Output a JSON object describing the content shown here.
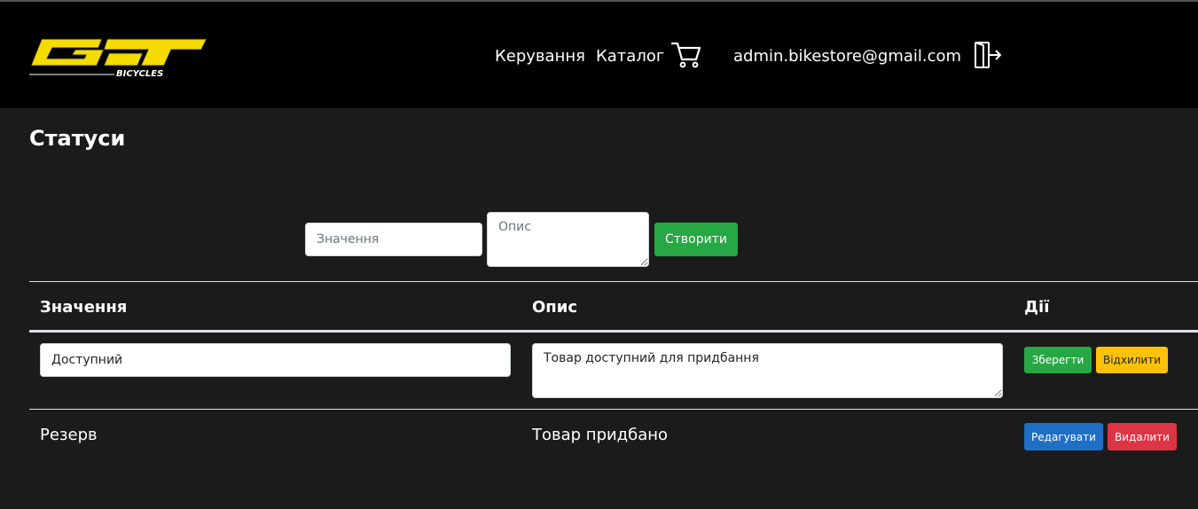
{
  "header": {
    "logo_text": "GT",
    "logo_subtext": "BICYCLES",
    "nav": {
      "management": "Керування",
      "catalog": "Каталог"
    },
    "cart_icon": "cart-icon",
    "user_email": "admin.bikestore@gmail.com",
    "logout_icon": "logout-icon"
  },
  "page": {
    "title": "Статуси"
  },
  "create_form": {
    "value_placeholder": "Значення",
    "description_placeholder": "Опис",
    "create_label": "Створити"
  },
  "table": {
    "headers": [
      "Значення",
      "Опис",
      "Дії"
    ],
    "editing_row": {
      "value": "Доступний",
      "description": "Товар доступний для придбання",
      "save_label": "Зберегти",
      "cancel_label": "Відхилити"
    },
    "rows": [
      {
        "value": "Резерв",
        "description": "Товар придбано",
        "edit_label": "Редагувати",
        "delete_label": "Видалити"
      }
    ]
  },
  "colors": {
    "header_bg": "#000000",
    "page_bg": "#1b1b1b",
    "logo_yellow": "#f5dc00",
    "success": "#28a745",
    "warning": "#ffc107",
    "primary": "#1f6fc5",
    "danger": "#dc3545"
  }
}
